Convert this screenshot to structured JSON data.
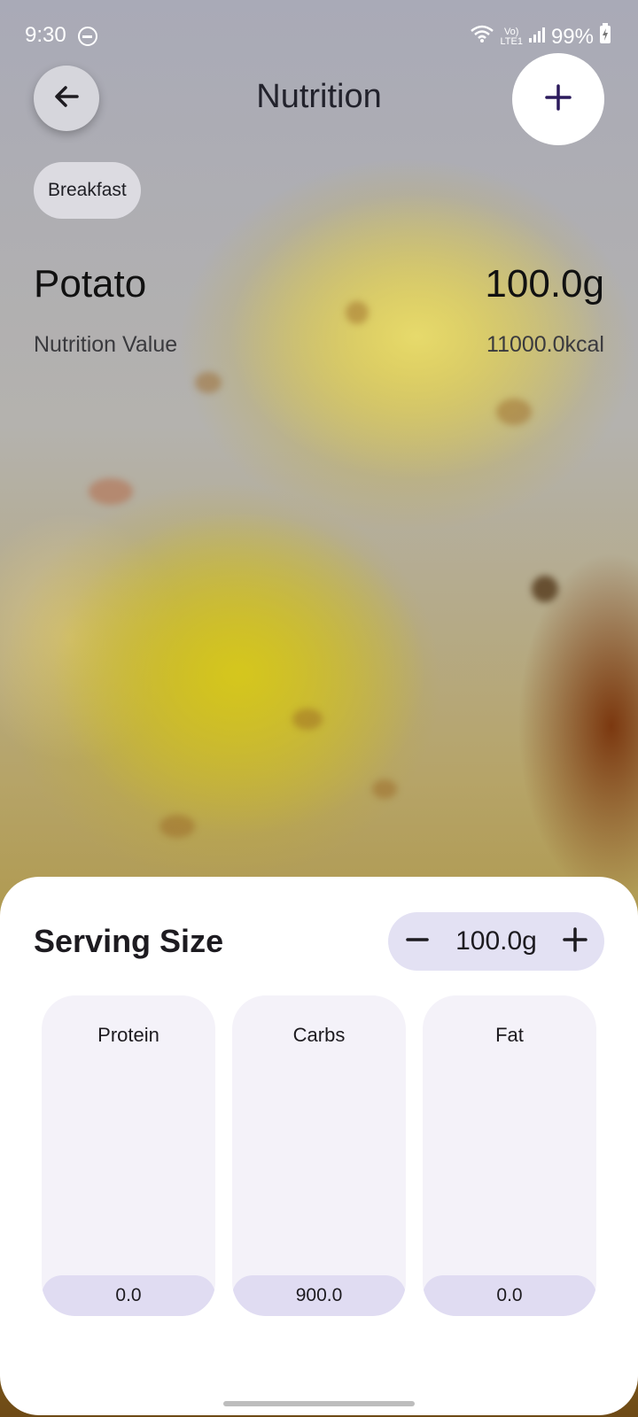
{
  "status_bar": {
    "time": "9:30",
    "battery": "99%",
    "icons": [
      "do-not-disturb-icon",
      "wifi-icon",
      "volte-icon",
      "signal-icon",
      "battery-charging-icon"
    ],
    "network_label": "LTE1"
  },
  "header": {
    "title": "Nutrition",
    "back_icon": "arrow-left-icon",
    "add_icon": "plus-icon"
  },
  "meal_chip": {
    "label": "Breakfast"
  },
  "food": {
    "name": "Potato",
    "weight": "100.0g",
    "nutrition_label": "Nutrition Value",
    "nutrition_value": "11000.0kcal"
  },
  "serving": {
    "title": "Serving Size",
    "value": "100.0g",
    "decrement_icon": "minus-icon",
    "increment_icon": "plus-icon"
  },
  "macros": [
    {
      "label": "Protein",
      "value": "0.0"
    },
    {
      "label": "Carbs",
      "value": "900.0"
    },
    {
      "label": "Fat",
      "value": "0.0"
    }
  ],
  "colors": {
    "accent": "#2b1a5c",
    "chip_bg": "#dcdbe1",
    "stepper_bg": "#e3e1f3",
    "card_bg": "#f4f2f9",
    "bar_bg": "#e0dcf2"
  }
}
